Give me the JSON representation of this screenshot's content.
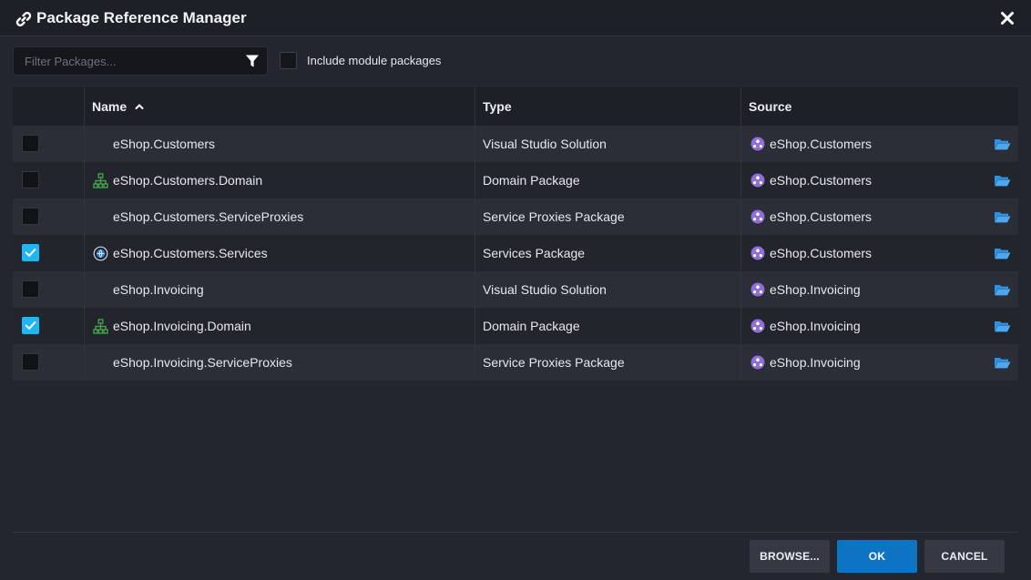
{
  "window": {
    "title": "Package Reference Manager",
    "title_icon": "link-icon",
    "close_icon": "close-icon"
  },
  "toolbar": {
    "filter_placeholder": "Filter Packages...",
    "filter_value": "",
    "filter_icon": "funnel-icon",
    "include_module_label": "Include module packages",
    "include_module_checked": false
  },
  "table": {
    "columns": [
      {
        "label": "",
        "key": "selected"
      },
      {
        "label": "Name",
        "key": "name",
        "sort": "ascending"
      },
      {
        "label": "Type",
        "key": "type"
      },
      {
        "label": "Source",
        "key": "source"
      }
    ],
    "rows": [
      {
        "checked": false,
        "icon": "",
        "name": "eShop.Customers",
        "type": "Visual Studio Solution",
        "source": "eShop.Customers"
      },
      {
        "checked": false,
        "icon": "domain-hierarchy-icon",
        "name": "eShop.Customers.Domain",
        "type": "Domain Package",
        "source": "eShop.Customers"
      },
      {
        "checked": false,
        "icon": "",
        "name": "eShop.Customers.ServiceProxies",
        "type": "Service Proxies Package",
        "source": "eShop.Customers"
      },
      {
        "checked": true,
        "icon": "services-globe-icon",
        "name": "eShop.Customers.Services",
        "type": "Services Package",
        "source": "eShop.Customers"
      },
      {
        "checked": false,
        "icon": "",
        "name": "eShop.Invoicing",
        "type": "Visual Studio Solution",
        "source": "eShop.Invoicing"
      },
      {
        "checked": true,
        "icon": "domain-hierarchy-icon",
        "name": "eShop.Invoicing.Domain",
        "type": "Domain Package",
        "source": "eShop.Invoicing"
      },
      {
        "checked": false,
        "icon": "",
        "name": "eShop.Invoicing.ServiceProxies",
        "type": "Service Proxies Package",
        "source": "eShop.Invoicing"
      }
    ]
  },
  "buttons": {
    "browse": "BROWSE...",
    "ok": "OK",
    "cancel": "CANCEL"
  },
  "colors": {
    "accent": "#1fb6f2",
    "primary_button": "#0c74c2",
    "domain_icon": "#3fa34d",
    "source_icon": "#8e6fd8",
    "folder_icon": "#2f8fe0"
  }
}
